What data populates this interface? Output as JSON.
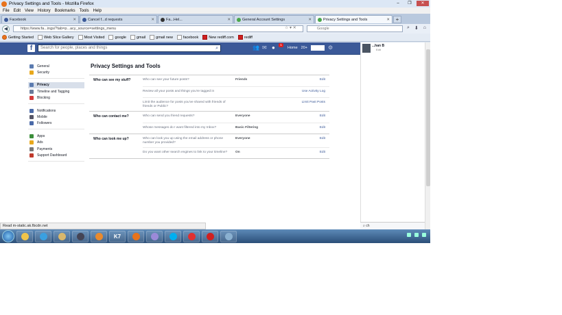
{
  "window": {
    "title": "Privacy Settings and Tools - Mozilla Firefox",
    "controls": [
      "–",
      "❐",
      "✕"
    ]
  },
  "menu": [
    "File",
    "Edit",
    "View",
    "History",
    "Bookmarks",
    "Tools",
    "Help"
  ],
  "tabs": [
    {
      "label": "Facebook"
    },
    {
      "label": "Cancel f...d requests"
    },
    {
      "label": "Fa...Hel..."
    },
    {
      "label": "General Account Settings"
    },
    {
      "label": "Privacy Settings and Tools"
    }
  ],
  "url": "https://www.fa...ings/?tab=p...acy_source=settings_menu",
  "search_placeholder": "Google",
  "bookmarks": [
    "Getting Started",
    "Web Slice Gallery",
    "Most Visited",
    "google",
    "gmail",
    "gmail new",
    "facebook",
    "New rediff.com",
    "rediff"
  ],
  "fb": {
    "search_placeholder": "Search for people, places and things",
    "notif_count": "1",
    "home": "Home",
    "count": "20+",
    "profile_name": "...han B",
    "profile_sub": "Edit"
  },
  "leftnav": {
    "groups": [
      [
        {
          "label": "General",
          "color": "#5b7bb0"
        },
        {
          "label": "Security",
          "color": "#e8a81c"
        }
      ],
      [
        {
          "label": "Privacy",
          "color": "#5b7bb0",
          "active": true
        },
        {
          "label": "Timeline and Tagging",
          "color": "#6a7a9a"
        },
        {
          "label": "Blocking",
          "color": "#d53a3a"
        }
      ],
      [
        {
          "label": "Notifications",
          "color": "#4a6aa8"
        },
        {
          "label": "Mobile",
          "color": "#556"
        },
        {
          "label": "Followers",
          "color": "#4a6aa8"
        }
      ],
      [
        {
          "label": "Apps",
          "color": "#3b8e3b"
        },
        {
          "label": "Ads",
          "color": "#e8a81c"
        },
        {
          "label": "Payments",
          "color": "#777"
        },
        {
          "label": "Support Dashboard",
          "color": "#c0392b"
        }
      ]
    ]
  },
  "page_title": "Privacy Settings and Tools",
  "sections": [
    {
      "title": "Who can see my stuff?",
      "rows": [
        {
          "question": "Who can see your future posts?",
          "value": "Friends",
          "action": "Edit"
        },
        {
          "question": "Review all your posts and things you're tagged in",
          "value": "",
          "action": "Use Activity Log"
        },
        {
          "question": "Limit the audience for posts you've shared with friends of friends or Public?",
          "value": "",
          "action": "Limit Past Posts"
        }
      ]
    },
    {
      "title": "Who can contact me?",
      "rows": [
        {
          "question": "Who can send you friend requests?",
          "value": "Everyone",
          "action": "Edit"
        },
        {
          "question": "Whose messages do I want filtered into my Inbox?",
          "value": "Basic Filtering",
          "action": "Edit"
        }
      ]
    },
    {
      "title": "Who can look me up?",
      "rows": [
        {
          "question": "Who can look you up using the email address or phone number you provided?",
          "value": "Everyone",
          "action": "Edit"
        },
        {
          "question": "Do you want other search engines to link to your timeline?",
          "value": "On",
          "action": "Edit"
        }
      ]
    }
  ],
  "chat_search": "ch",
  "status": "Read m-static.ak.fbcdn.net",
  "taskbar_label": "K7"
}
